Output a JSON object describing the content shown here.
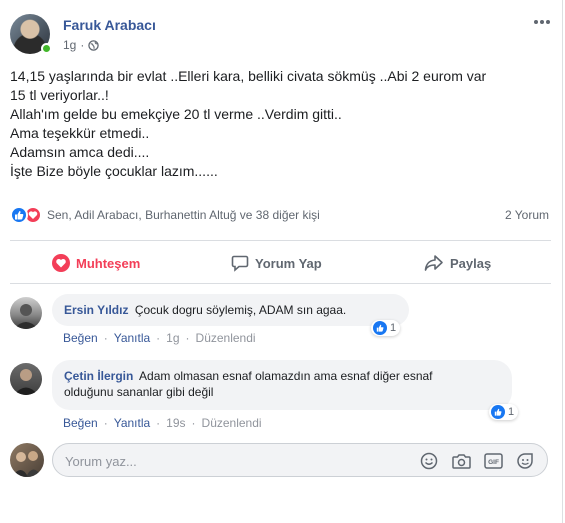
{
  "post": {
    "author": "Faruk Arabacı",
    "time": "1g",
    "lines": [
      "14,15 yaşlarında bir evlat ..Elleri kara, belliki civata sökmüş ..Abi 2 eurom var",
      "15 tl veriyorlar..!",
      "Allah'ım gelde bu emekçiye 20 tl verme ..Verdim gitti..",
      "Ama teşekkür etmedi..",
      "Adamsın amca dedi....",
      "İşte Bize böyle çocuklar lazım......"
    ]
  },
  "reactions_summary": {
    "text": "Sen, Adil Arabacı, Burhanettin Altuğ ve 38 diğer kişi",
    "comment_count": "2 Yorum"
  },
  "actions": {
    "react_label": "Muhteşem",
    "comment_label": "Yorum Yap",
    "share_label": "Paylaş"
  },
  "comments": [
    {
      "name": "Ersin Yıldız",
      "text": "Çocuk dogru söylemiş, ADAM sın agaa.",
      "like": "Beğen",
      "reply": "Yanıtla",
      "time": "1g",
      "edited": "Düzenlendi",
      "reaction_count": "1"
    },
    {
      "name": "Çetin İlergin",
      "text_line1": "Adam olmasan esnaf olamazdın ama esnaf diğer esnaf",
      "text_line2": "olduğunu sananlar gibi değil",
      "like": "Beğen",
      "reply": "Yanıtla",
      "time": "19s",
      "edited": "Düzenlendi",
      "reaction_count": "1"
    }
  ],
  "composer": {
    "placeholder": "Yorum yaz..."
  },
  "colors": {
    "link": "#385898",
    "love": "#f33e58",
    "like": "#1877f2",
    "muted": "#606770"
  }
}
